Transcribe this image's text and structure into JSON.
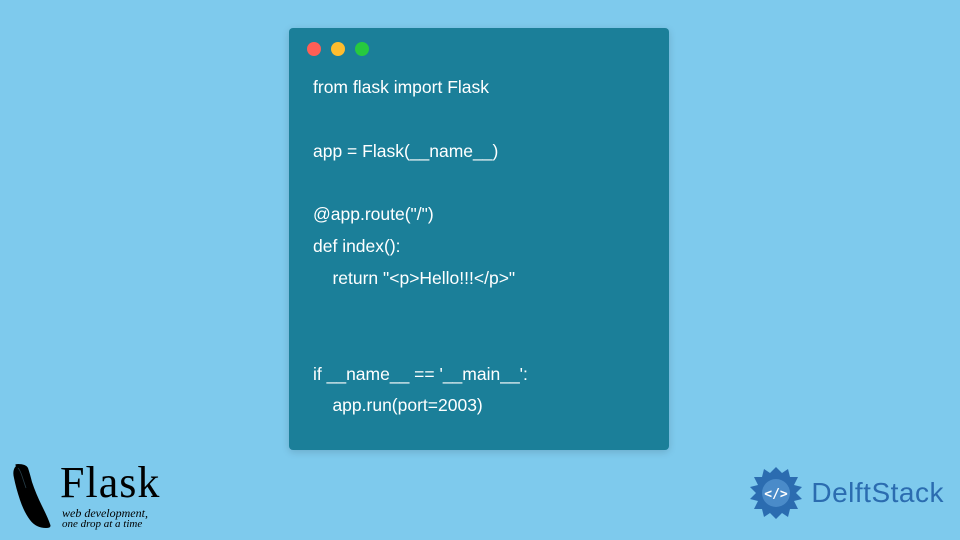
{
  "code": {
    "lines": "from flask import Flask\n\napp = Flask(__name__)\n\n@app.route(\"/\")\ndef index():\n    return \"<p>Hello!!!</p>\"\n\n\nif __name__ == '__main__':\n    app.run(port=2003)"
  },
  "flask_logo": {
    "title": "Flask",
    "subtitle1": "web development,",
    "subtitle2": "one drop at a time"
  },
  "delft_logo": {
    "text": "DelftStack"
  },
  "colors": {
    "page_bg": "#7ecaed",
    "window_bg": "#1b7f99",
    "code_text": "#ffffff",
    "tl_red": "#ff5f56",
    "tl_yellow": "#ffbd2e",
    "tl_green": "#27c93f",
    "delft_blue": "#2b6cb0"
  }
}
